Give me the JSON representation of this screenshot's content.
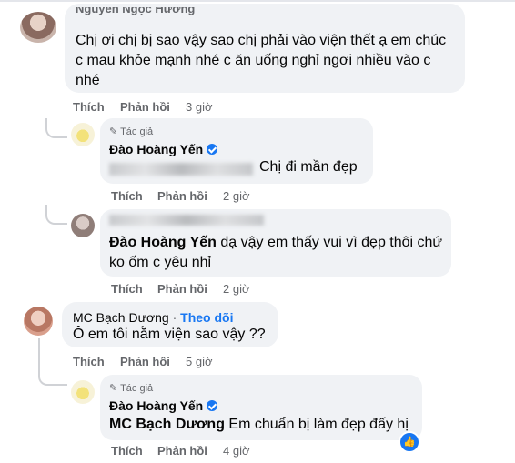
{
  "comments": [
    {
      "id": "c1",
      "author": "Nguyễn Ngọc Hương",
      "text_lines": [
        "Chị ơi chị bị sao vậy sao chị phải vào viện thết ạ em chúc",
        "c mau khỏe mạnh nhé c ăn uống nghỉ ngơi nhiều vào c",
        "nhé"
      ],
      "like": "Thích",
      "reply": "Phản hồi",
      "time": "3 giờ"
    },
    {
      "id": "r1",
      "author_tag": "Tác giả",
      "author": "Đào Hoàng Yến",
      "text": "Chị đi mần đẹp",
      "like": "Thích",
      "reply": "Phản hồi",
      "time": "2 giờ"
    },
    {
      "id": "r2",
      "author": "Đào Hoàng Yến",
      "text_lines": [
        "dạ vậy em thấy vui vì đẹp thôi chứ",
        "ko ốm c yêu nhỉ"
      ],
      "like": "Thích",
      "reply": "Phản hồi",
      "time": "2 giờ"
    },
    {
      "id": "c2",
      "author": "MC Bạch Dương",
      "follow": "Theo dõi",
      "text": "Ô em tôi nằm viện sao vậy ??",
      "like": "Thích",
      "reply": "Phản hồi",
      "time": "5 giờ"
    },
    {
      "id": "r3",
      "author_tag": "Tác giả",
      "author": "Đào Hoàng Yến",
      "mention": "MC Bạch Dương",
      "text": "Em chuẩn bị làm đẹp đấy hị",
      "like": "Thích",
      "reply": "Phản hồi",
      "time": "4 giờ"
    }
  ],
  "icons": {
    "verified": "verified-badge-icon",
    "author_badge": "pencil-icon",
    "reaction": "like-reaction-icon"
  },
  "colors": {
    "bubble": "#f0f2f5",
    "link": "#1877f2",
    "meta": "#65676b"
  }
}
